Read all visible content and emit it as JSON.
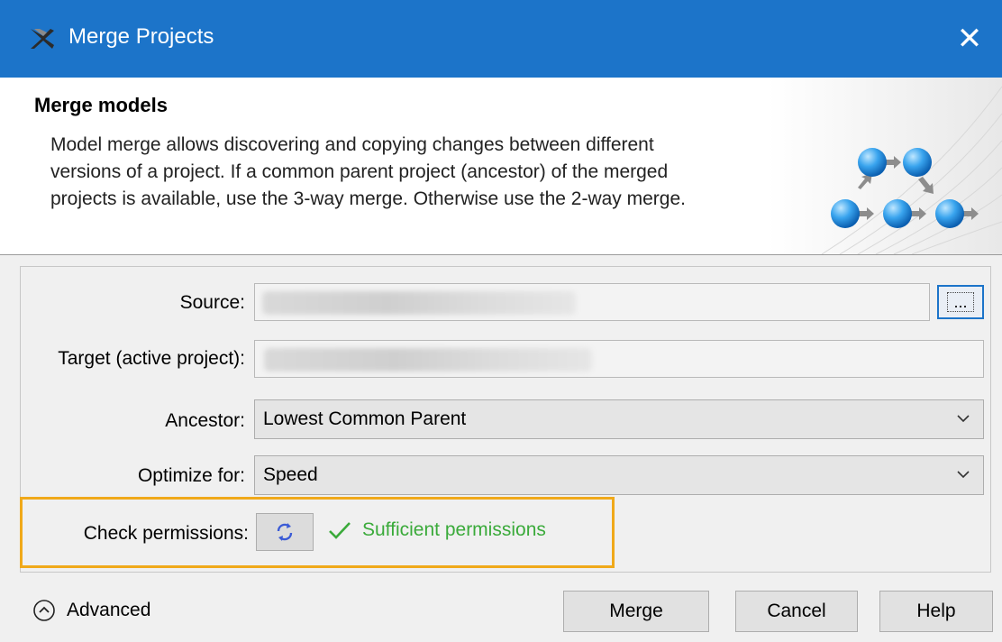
{
  "window": {
    "title": "Merge Projects",
    "close_glyph": "✕"
  },
  "header": {
    "title": "Merge models",
    "description_lines": [
      "Model merge allows discovering and copying changes between different",
      "versions of a project. If a common parent project (ancestor) of the merged",
      "projects is available, use the 3-way merge. Otherwise use the 2-way merge."
    ]
  },
  "form": {
    "source": {
      "label": "Source:",
      "value": "",
      "browse_label": "..."
    },
    "target": {
      "label": "Target (active project):",
      "value": ""
    },
    "ancestor": {
      "label": "Ancestor:",
      "selected": "Lowest Common Parent"
    },
    "optimize": {
      "label": "Optimize for:",
      "selected": "Speed"
    },
    "permissions": {
      "label": "Check permissions:",
      "status": "Sufficient permissions"
    }
  },
  "footer": {
    "advanced_label": "Advanced",
    "merge_label": "Merge",
    "cancel_label": "Cancel",
    "help_label": "Help"
  },
  "colors": {
    "titlebar": "#1c74c9",
    "highlight_border": "#f0a91a",
    "status_ok": "#3aaa3a"
  }
}
